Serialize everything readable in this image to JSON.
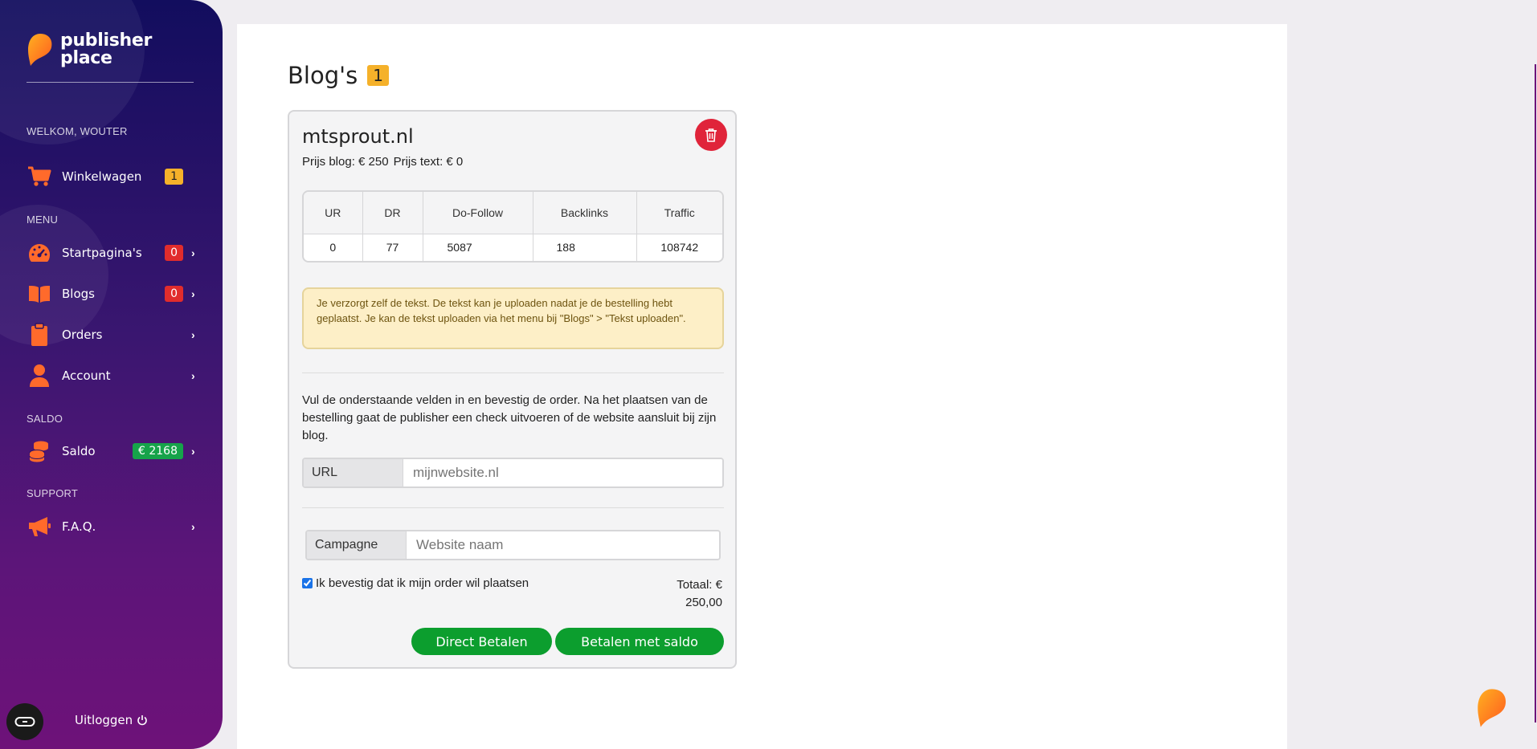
{
  "brand": {
    "name_line1": "publisher",
    "name_line2": "place"
  },
  "sidebar": {
    "welcome": "WELKOM, WOUTER",
    "cart": {
      "label": "Winkelwagen",
      "badge": "1"
    },
    "menu_label": "MENU",
    "menu": [
      {
        "label": "Startpagina's",
        "badge": "0",
        "icon": "speedometer-icon"
      },
      {
        "label": "Blogs",
        "badge": "0",
        "icon": "book-icon"
      },
      {
        "label": "Orders",
        "badge": "",
        "icon": "clipboard-icon"
      },
      {
        "label": "Account",
        "badge": "",
        "icon": "user-icon"
      }
    ],
    "saldo_label": "SALDO",
    "saldo": {
      "label": "Saldo",
      "badge": "€ 2168"
    },
    "support_label": "SUPPORT",
    "faq": {
      "label": "F.A.Q."
    },
    "logout": "Uitloggen",
    "colors": {
      "accent": "#ff6a2b",
      "gradient_top": "#120d5e",
      "gradient_bottom": "#6e1279"
    }
  },
  "page": {
    "title": "Blog's",
    "count": "1"
  },
  "blog": {
    "name": "mtsprout.nl",
    "price_blog": "Prijs blog: € 250",
    "price_text": "Prijs text: € 0",
    "stats_headers": [
      "UR",
      "DR",
      "Do-Follow",
      "Backlinks",
      "Traffic"
    ],
    "stats_values": [
      "0",
      "77",
      "5087",
      "188",
      "108742"
    ],
    "notice": "Je verzorgt zelf de tekst. De tekst kan je uploaden nadat je de bestelling hebt geplaatst. Je kan de tekst uploaden via het menu bij \"Blogs\" > \"Tekst uploaden\".",
    "intro": "Vul de onderstaande velden in en bevestig de order. Na het plaatsen van de bestelling gaat de publisher een check uitvoeren of de website aansluit bij zijn blog.",
    "url_label": "URL",
    "url_placeholder": "mijnwebsite.nl",
    "campaign_label": "Campagne",
    "campaign_placeholder": "Website naam",
    "confirm_label": "Ik bevestig dat ik mijn order wil plaatsen",
    "total": "Totaal: € 250,00",
    "btn_direct": "Direct Betalen",
    "btn_saldo": "Betalen met saldo"
  }
}
